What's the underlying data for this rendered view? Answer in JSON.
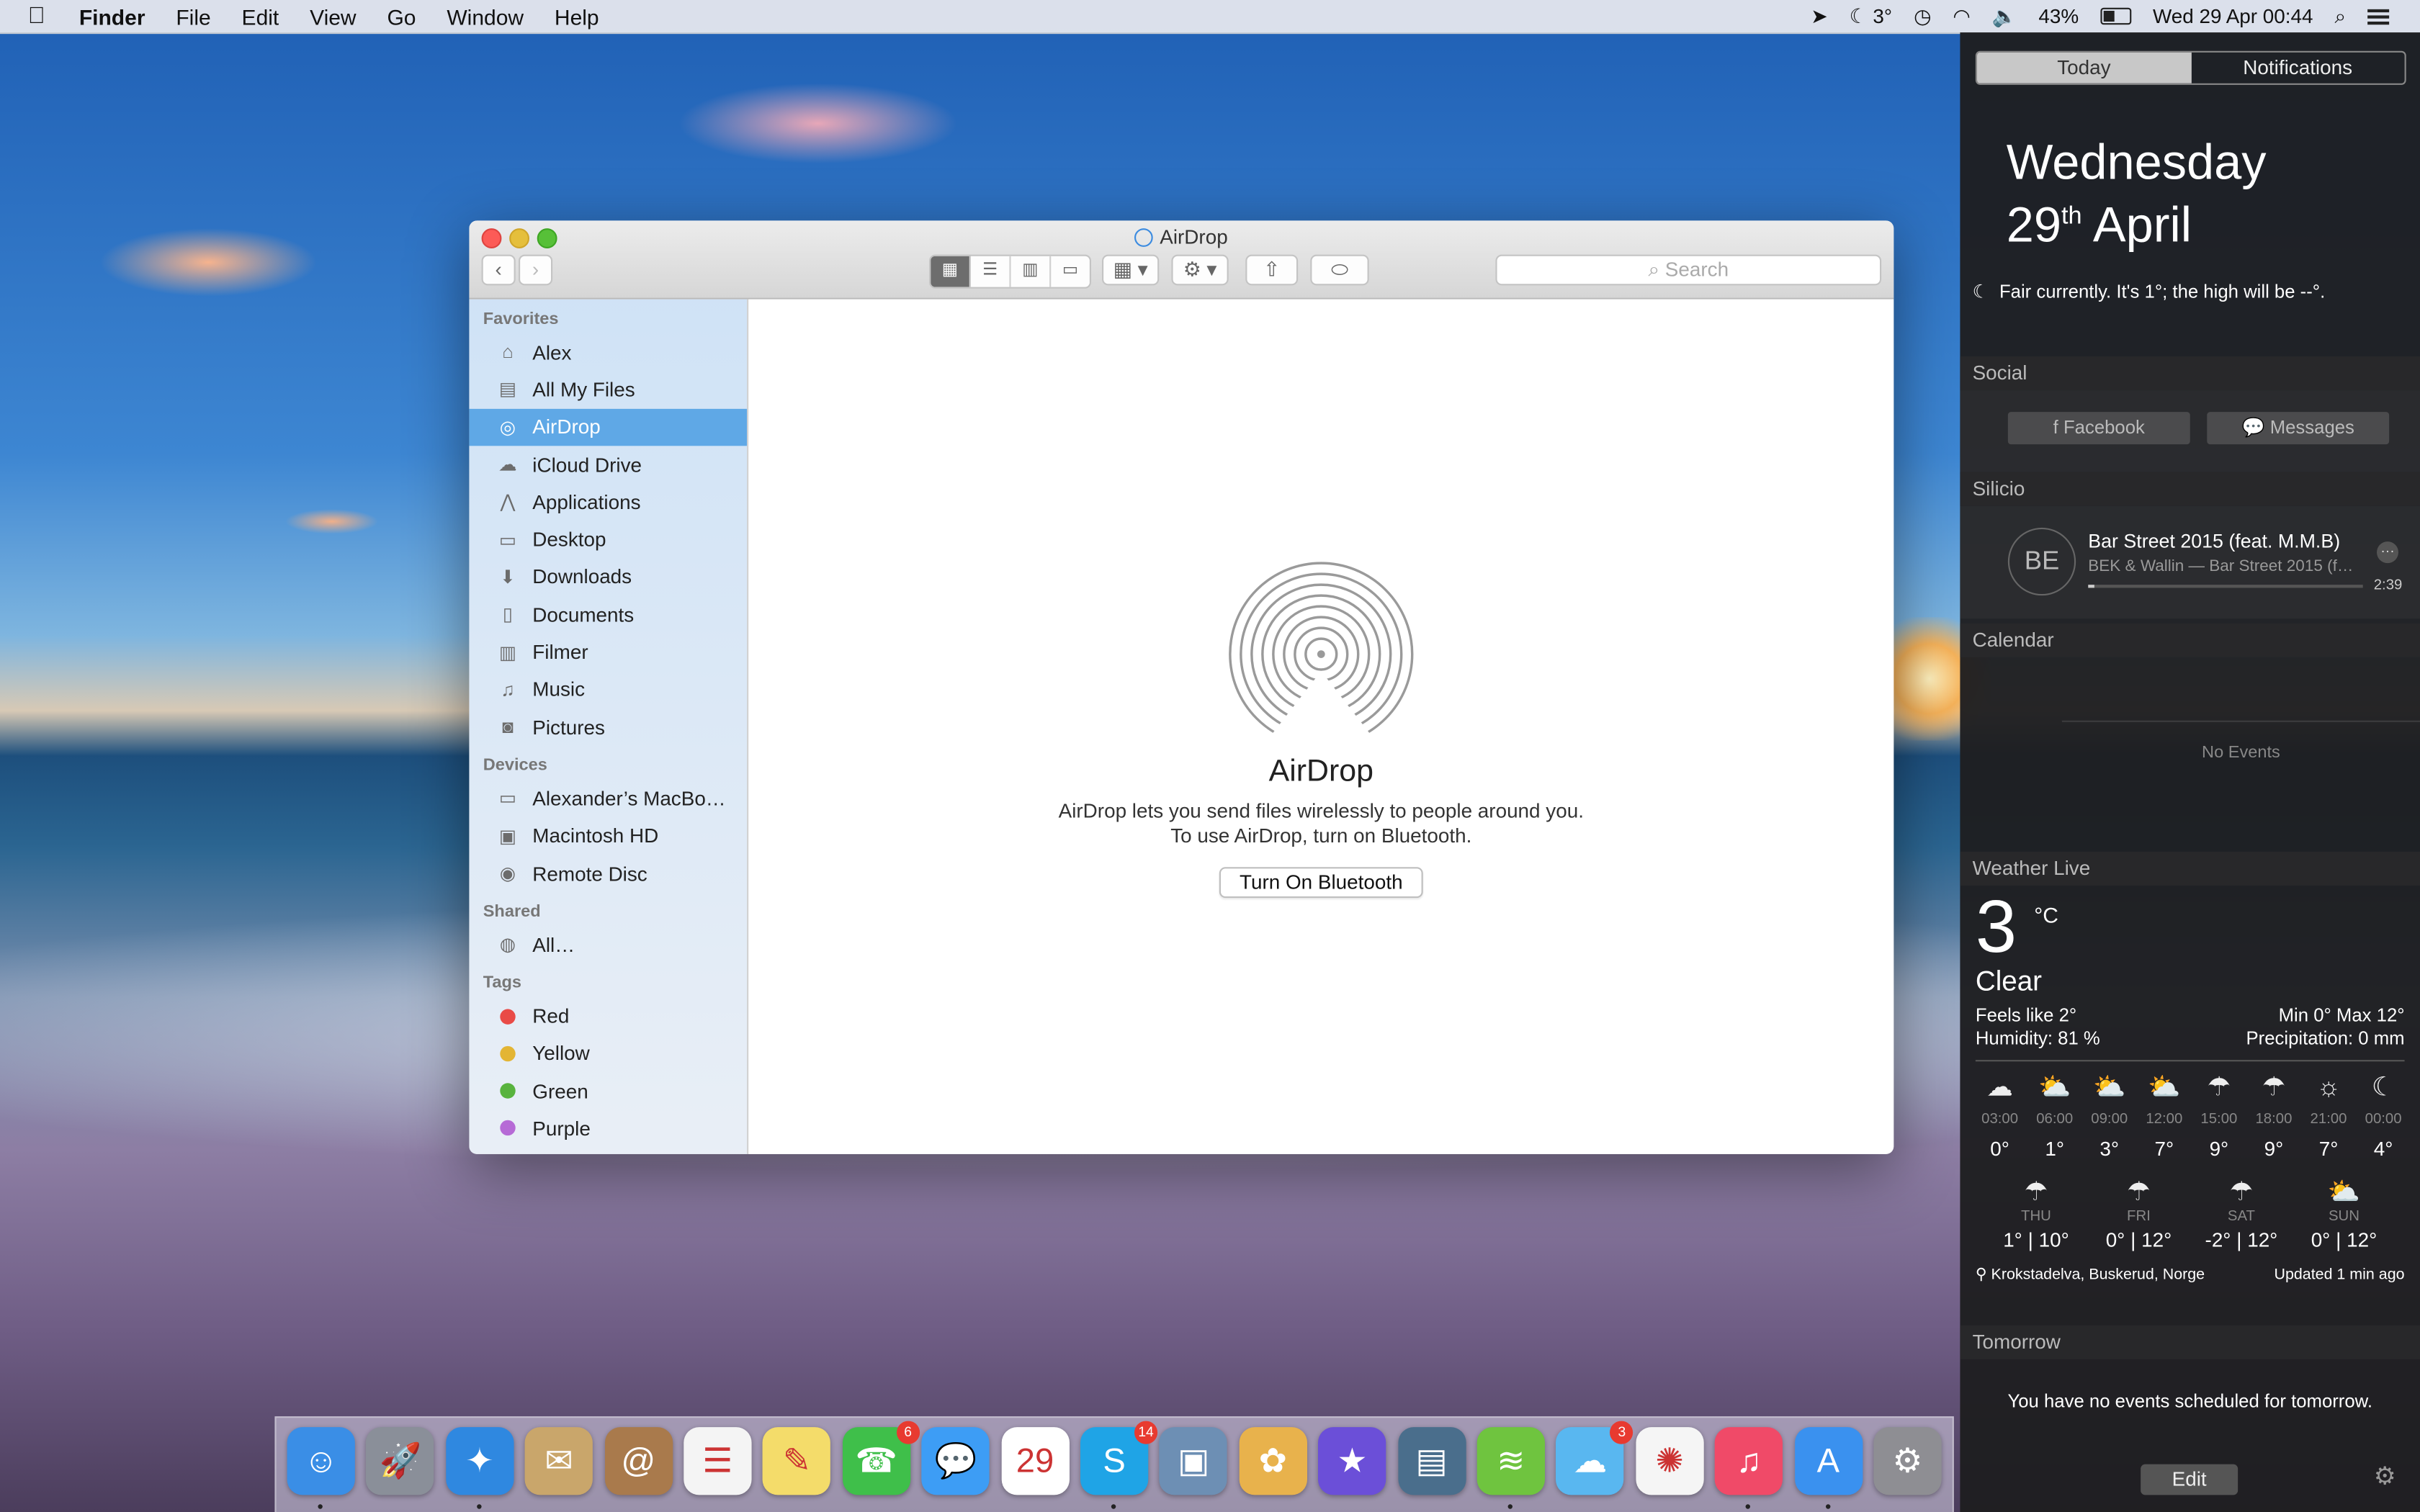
{
  "menubar": {
    "app": "Finder",
    "menus": [
      "File",
      "Edit",
      "View",
      "Go",
      "Window",
      "Help"
    ],
    "temperature": "3°",
    "battery": "43%",
    "battery_level": 0.43,
    "datetime": "Wed 29 Apr  00:44"
  },
  "finder": {
    "title": "AirDrop",
    "search_placeholder": "Search",
    "sidebar": {
      "favorites_label": "Favorites",
      "favorites": [
        {
          "label": "Alex",
          "icon": "home-icon"
        },
        {
          "label": "All My Files",
          "icon": "all-files-icon"
        },
        {
          "label": "AirDrop",
          "icon": "airdrop-icon"
        },
        {
          "label": "iCloud Drive",
          "icon": "cloud-icon"
        },
        {
          "label": "Applications",
          "icon": "applications-icon"
        },
        {
          "label": "Desktop",
          "icon": "desktop-icon"
        },
        {
          "label": "Downloads",
          "icon": "downloads-icon"
        },
        {
          "label": "Documents",
          "icon": "documents-icon"
        },
        {
          "label": "Filmer",
          "icon": "film-icon"
        },
        {
          "label": "Music",
          "icon": "music-icon"
        },
        {
          "label": "Pictures",
          "icon": "camera-icon"
        }
      ],
      "devices_label": "Devices",
      "devices": [
        {
          "label": "Alexander’s MacBo…",
          "icon": "laptop-icon"
        },
        {
          "label": "Macintosh HD",
          "icon": "hard-drive-icon"
        },
        {
          "label": "Remote Disc",
          "icon": "disc-icon"
        }
      ],
      "shared_label": "Shared",
      "shared": [
        {
          "label": "All…",
          "icon": "network-icon"
        }
      ],
      "tags_label": "Tags",
      "tags": [
        {
          "label": "Red",
          "color": "#e94b47"
        },
        {
          "label": "Yellow",
          "color": "#e3b534"
        },
        {
          "label": "Green",
          "color": "#58b33e"
        },
        {
          "label": "Purple",
          "color": "#b66ad6"
        }
      ]
    },
    "content": {
      "title": "AirDrop",
      "line1": "AirDrop lets you send files wirelessly to people around you.",
      "line2": "To use AirDrop, turn on Bluetooth.",
      "button": "Turn On Bluetooth"
    }
  },
  "notification_center": {
    "tabs": [
      "Today",
      "Notifications"
    ],
    "active_tab": "Today",
    "date_weekday": "Wednesday",
    "date_day": "29",
    "date_suffix": "th",
    "date_month": "April",
    "summary": "Fair currently. It's 1°; the high will be --°.",
    "social": {
      "title": "Social",
      "facebook": "Facebook",
      "messages": "Messages"
    },
    "music": {
      "title": "Silicio",
      "artwork": "BE",
      "track": "Bar Street 2015 (feat. M.M.B)",
      "subtitle": "BEK & Wallin — Bar Street 2015 (f…",
      "time": "2:39",
      "progress": 0.02
    },
    "calendar": {
      "title": "Calendar",
      "empty": "No Events"
    },
    "weather": {
      "title": "Weather Live",
      "temp": "3",
      "unit": "°C",
      "condition": "Clear",
      "feels": "Feels like 2°",
      "humidity": "Humidity: 81 %",
      "minmax": "Min 0°   Max 12°",
      "precip": "Precipitation: 0 mm",
      "hourly": [
        {
          "time": "03:00",
          "temp": "0°",
          "icon": "cloud-moon-icon"
        },
        {
          "time": "06:00",
          "temp": "1°",
          "icon": "partly-cloudy-icon"
        },
        {
          "time": "09:00",
          "temp": "3°",
          "icon": "partly-cloudy-icon"
        },
        {
          "time": "12:00",
          "temp": "7°",
          "icon": "partly-cloudy-icon"
        },
        {
          "time": "15:00",
          "temp": "9°",
          "icon": "rain-icon"
        },
        {
          "time": "18:00",
          "temp": "9°",
          "icon": "rain-icon"
        },
        {
          "time": "21:00",
          "temp": "7°",
          "icon": "sun-icon"
        },
        {
          "time": "00:00",
          "temp": "4°",
          "icon": "moon-icon"
        }
      ],
      "daily": [
        {
          "day": "THU",
          "low": "1°",
          "high": "10°",
          "icon": "rain-icon"
        },
        {
          "day": "FRI",
          "low": "0°",
          "high": "12°",
          "icon": "rain-icon"
        },
        {
          "day": "SAT",
          "low": "-2°",
          "high": "12°",
          "icon": "rain-icon"
        },
        {
          "day": "SUN",
          "low": "0°",
          "high": "12°",
          "icon": "partly-cloudy-icon"
        }
      ],
      "location": "Krokstadelva, Buskerud, Norge",
      "updated": "Updated 1 min ago"
    },
    "tomorrow": {
      "title": "Tomorrow",
      "text": "You have no events scheduled for tomorrow."
    },
    "edit": "Edit"
  },
  "dock": {
    "apps": [
      {
        "name": "finder",
        "color": "#3a8ee6",
        "glyph": "☺",
        "running": true
      },
      {
        "name": "launchpad",
        "color": "#8a8f99",
        "glyph": "🚀",
        "running": false
      },
      {
        "name": "safari",
        "color": "#2f88e0",
        "glyph": "✦",
        "running": true
      },
      {
        "name": "mail",
        "color": "#c9a66b",
        "glyph": "✉",
        "running": false
      },
      {
        "name": "contacts",
        "color": "#a97a4c",
        "glyph": "@",
        "running": false
      },
      {
        "name": "reminders",
        "color": "#f4f4f4",
        "glyph": "☰",
        "running": false
      },
      {
        "name": "notes",
        "color": "#f4dc6a",
        "glyph": "✎",
        "running": false
      },
      {
        "name": "facetime",
        "color": "#3fbf4a",
        "glyph": "☎",
        "badge": "6",
        "running": false
      },
      {
        "name": "messages",
        "color": "#3d9df5",
        "glyph": "💬",
        "running": false
      },
      {
        "name": "calendar",
        "color": "#ffffff",
        "glyph": "29",
        "running": false
      },
      {
        "name": "skype",
        "color": "#1fa4e6",
        "glyph": "S",
        "badge": "14",
        "running": true
      },
      {
        "name": "preview",
        "color": "#6d8fb4",
        "glyph": "▣",
        "running": false
      },
      {
        "name": "popcorn",
        "color": "#e8b24c",
        "glyph": "✿",
        "running": false
      },
      {
        "name": "imovie",
        "color": "#6b4fd8",
        "glyph": "★",
        "running": false
      },
      {
        "name": "final-cut",
        "color": "#4a6e8c",
        "glyph": "▤",
        "running": false
      },
      {
        "name": "spotify",
        "color": "#6fc43f",
        "glyph": "≋",
        "running": true
      },
      {
        "name": "weather",
        "color": "#59b7f0",
        "glyph": "☁",
        "badge": "3",
        "running": false
      },
      {
        "name": "photos",
        "color": "#f5f5f5",
        "glyph": "✺",
        "running": false
      },
      {
        "name": "itunes",
        "color": "#f04a68",
        "glyph": "♫",
        "running": true
      },
      {
        "name": "app-store",
        "color": "#3a91ef",
        "glyph": "A",
        "running": true
      },
      {
        "name": "system-preferences",
        "color": "#8e8e93",
        "glyph": "⚙",
        "running": false
      }
    ]
  }
}
